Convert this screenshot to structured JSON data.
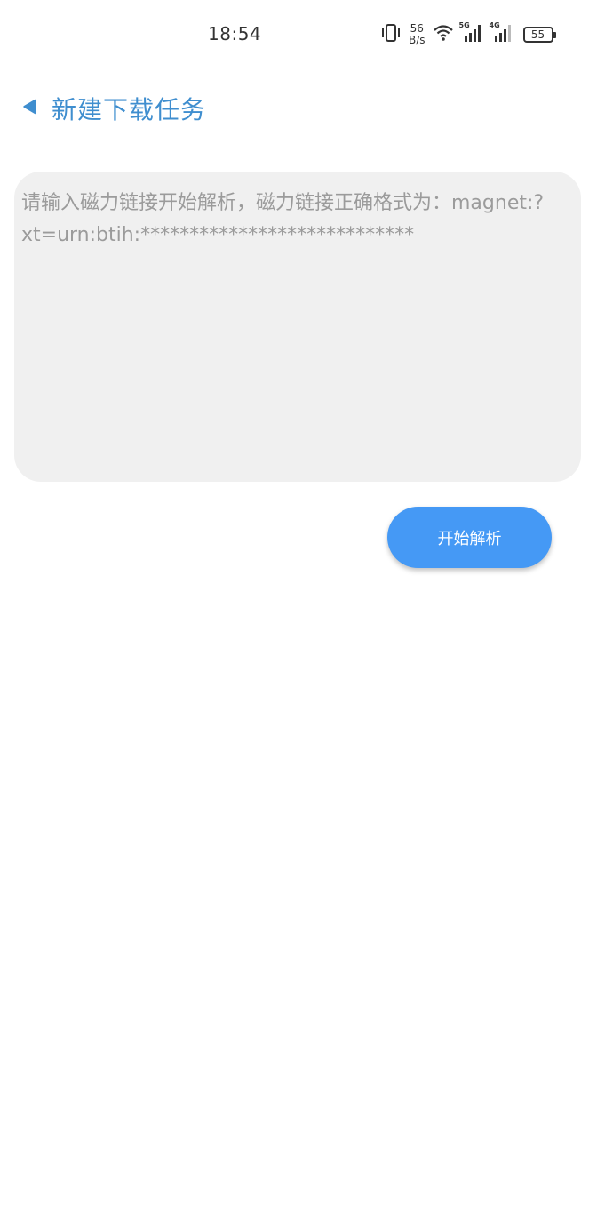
{
  "status_bar": {
    "time": "18:54",
    "net_speed_value": "56",
    "net_speed_unit": "B/s",
    "signal1_label": "5G",
    "signal2_label": "4G",
    "battery": "55",
    "icons": [
      "vibrate-icon",
      "wifi-icon",
      "signal-icon",
      "battery-icon"
    ]
  },
  "header": {
    "title": "新建下载任务",
    "back_icon": "back-triangle-icon"
  },
  "magnet_input": {
    "value": "",
    "placeholder": "请输入磁力链接开始解析，磁力链接正确格式为：magnet:?xt=urn:btih:****************************"
  },
  "actions": {
    "parse_label": "开始解析"
  },
  "colors": {
    "title": "#3f8ecf",
    "button": "#4599f5",
    "input_bg": "#f0f0f0",
    "placeholder": "#9b9b9b"
  }
}
